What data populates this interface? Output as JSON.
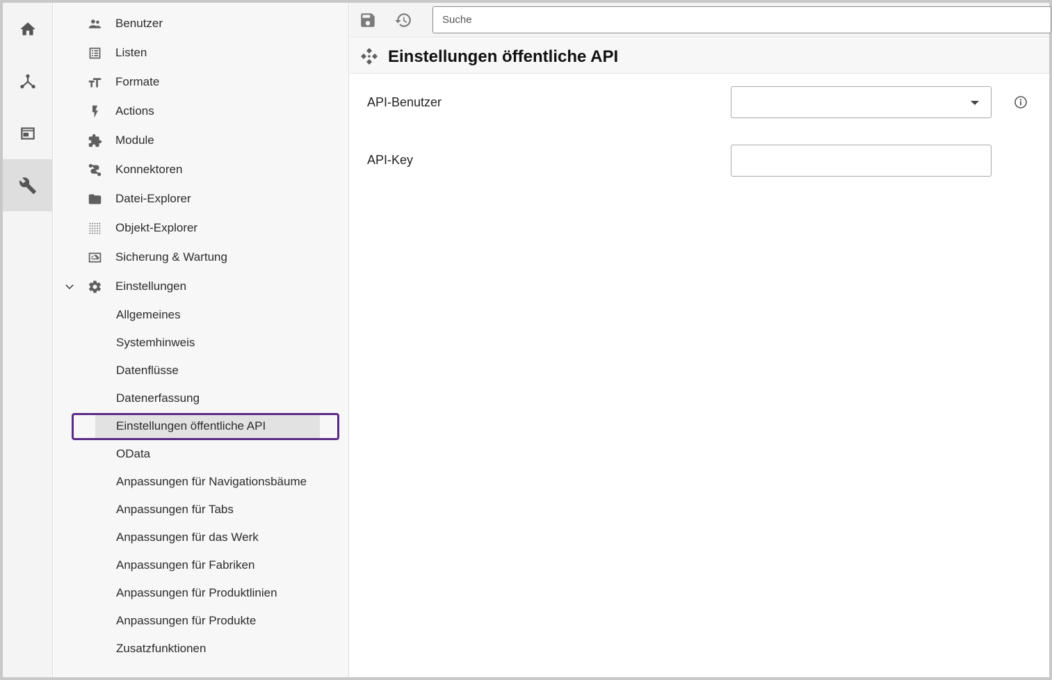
{
  "rail": {
    "items": [
      {
        "icon": "home-icon"
      },
      {
        "icon": "hierarchy-icon"
      },
      {
        "icon": "window-icon"
      },
      {
        "icon": "wrench-icon"
      }
    ]
  },
  "tree": {
    "items": [
      {
        "label": "Benutzer",
        "icon": "users-icon"
      },
      {
        "label": "Listen",
        "icon": "list-icon"
      },
      {
        "label": "Formate",
        "icon": "text-format-icon"
      },
      {
        "label": "Actions",
        "icon": "lightning-icon"
      },
      {
        "label": "Module",
        "icon": "puzzle-icon"
      },
      {
        "label": "Konnektoren",
        "icon": "route-icon"
      },
      {
        "label": "Datei-Explorer",
        "icon": "folder-icon"
      },
      {
        "label": "Objekt-Explorer",
        "icon": "dot-grid-icon"
      },
      {
        "label": "Sicherung & Wartung",
        "icon": "backup-icon"
      },
      {
        "label": "Einstellungen",
        "icon": "gear-icon"
      }
    ],
    "sub_items": [
      {
        "label": "Allgemeines"
      },
      {
        "label": "Systemhinweis"
      },
      {
        "label": "Datenflüsse"
      },
      {
        "label": "Datenerfassung"
      },
      {
        "label": "Einstellungen öffentliche API"
      },
      {
        "label": "OData"
      },
      {
        "label": "Anpassungen für Navigationsbäume"
      },
      {
        "label": "Anpassungen für Tabs"
      },
      {
        "label": "Anpassungen für das Werk"
      },
      {
        "label": "Anpassungen für Fabriken"
      },
      {
        "label": "Anpassungen für Produktlinien"
      },
      {
        "label": "Anpassungen für Produkte"
      },
      {
        "label": "Zusatzfunktionen"
      }
    ]
  },
  "toolbar": {
    "search_placeholder": "Suche"
  },
  "page": {
    "title": "Einstellungen öffentliche API",
    "fields": {
      "api_user_label": "API-Benutzer",
      "api_user_value": "",
      "api_key_label": "API-Key",
      "api_key_value": ""
    }
  },
  "colors": {
    "highlight": "#5b2a86",
    "rail_active": "#dedede"
  }
}
